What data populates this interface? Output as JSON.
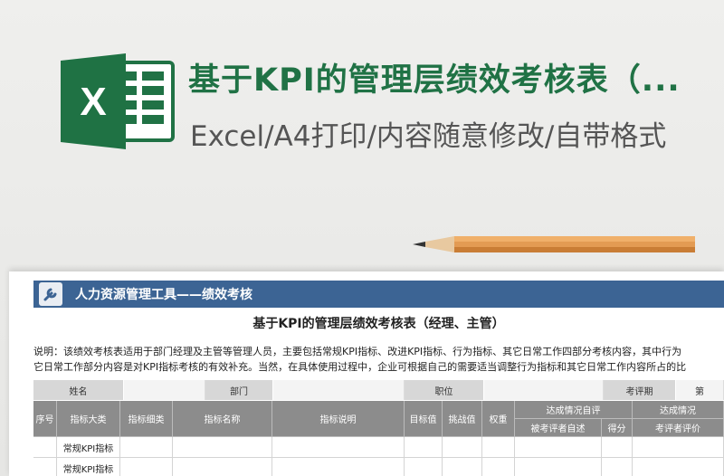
{
  "banner": {
    "title": "基于KPI的管理层绩效考核表（...",
    "subtitle": "Excel/A4打印/内容随意修改/自带格式"
  },
  "colors": {
    "excel_green": "#207245",
    "toolbar_blue": "#3c6494",
    "header_gray": "#8c8c8c"
  },
  "sheet": {
    "toolbar_title": "人力资源管理工具——绩效考核",
    "doc_title": "基于KPI的管理层绩效考核表（经理、主管）",
    "note_line1": "说明：该绩效考核表适用于部门经理及主管等管理人员，主要包括常规KPI指标、改进KPI指标、行为指标、其它日常工作四部分考核内容，其中行为",
    "note_line2": "它日常工作部分内容是对KPI指标考核的有效补充。当然，在具体使用过程中，企业可根据自己的需要适当调整行为指标和其它日常工作内容所占的比",
    "info": {
      "name": "姓名",
      "dept": "部门",
      "position": "职位",
      "period": "考评期",
      "period_val": "第"
    },
    "header": {
      "seq": "序号",
      "category": "指标大类",
      "subcategory": "指标细类",
      "name": "指标名称",
      "desc": "指标说明",
      "target": "目标值",
      "challenge": "挑战值",
      "weight": "权重",
      "self_group": "达成情况自评",
      "self_eval": "被考评者自述",
      "score": "得分",
      "rev_group": "达成情况",
      "rev_eval": "考评者评价"
    },
    "rows": [
      {
        "category": "常规KPI指标"
      },
      {
        "category": "常规KPI指标"
      }
    ]
  }
}
